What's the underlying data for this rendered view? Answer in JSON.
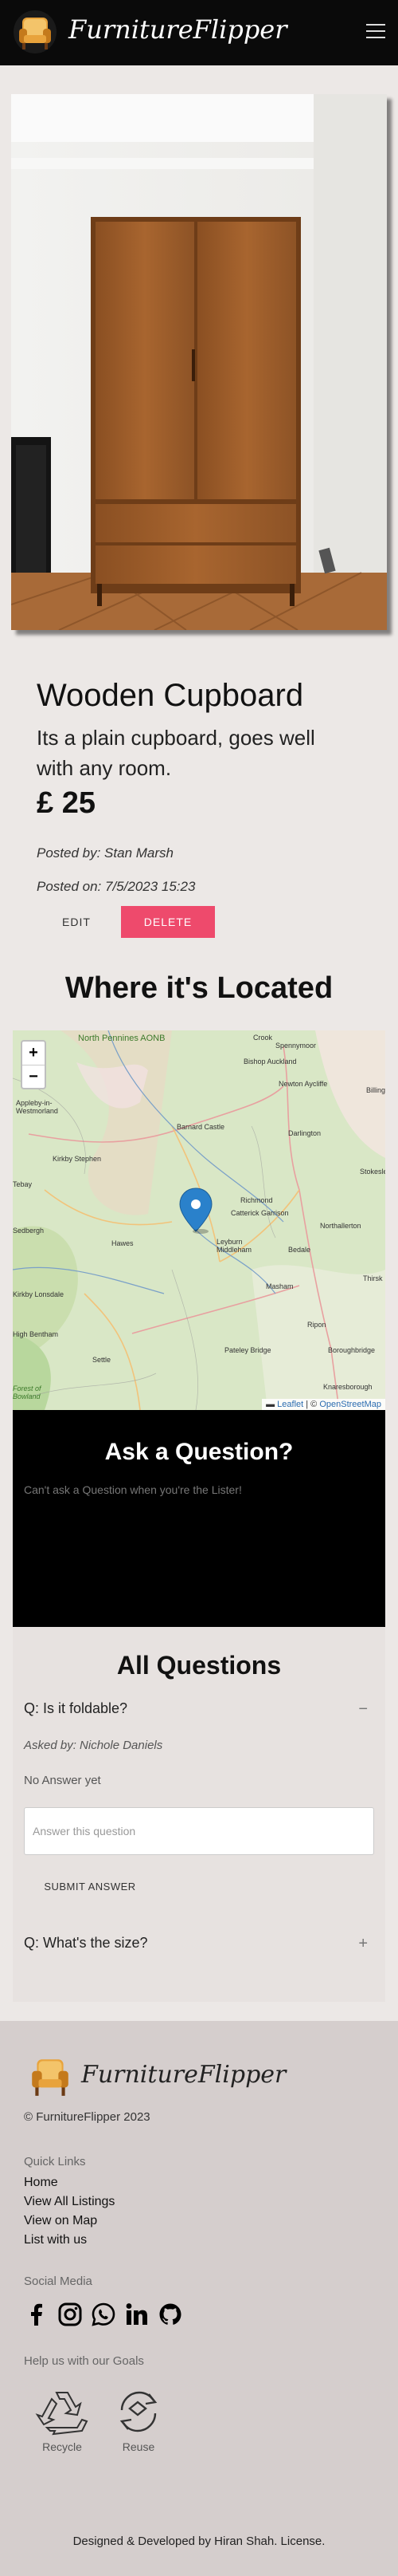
{
  "navbar": {
    "brand": "FurnitureFlipper"
  },
  "listing": {
    "title": "Wooden Cupboard",
    "description": "Its a plain cupboard, goes well with any room.",
    "price": "£ 25",
    "posted_by": "Posted by: Stan Marsh",
    "posted_on": "Posted on: 7/5/2023 15:23",
    "edit_label": "EDIT",
    "delete_label": "DELETE"
  },
  "map": {
    "heading": "Where it's Located",
    "zoom_in": "+",
    "zoom_out": "−",
    "attribution_leaflet": "Leaflet",
    "attribution_sep": " | © ",
    "attribution_osm": "OpenStreetMap",
    "labels": [
      "North Pennines AONB",
      "Crook",
      "Spennymoor",
      "Bishop Auckland",
      "Newton Aycliffe",
      "Darlington",
      "Appleby-in-Westmorland",
      "Barnard Castle",
      "Kirkby Stephen",
      "Richmond",
      "Catterick Garrison",
      "Northallerton",
      "Leyburn",
      "Middleham",
      "Bedale",
      "Hawes",
      "Masham",
      "Thirsk",
      "Sedbergh",
      "Ripon",
      "Pateley Bridge",
      "Boroughbridge",
      "High Bentham",
      "Settle",
      "Forest of Bowland",
      "Knaresborough",
      "Billingham",
      "Stokesley",
      "Kirkby Lonsdale",
      "Tebay"
    ]
  },
  "ask": {
    "title": "Ask a Question?",
    "note": "Can't ask a Question when you're the Lister!"
  },
  "questions": {
    "heading": "All Questions",
    "items": [
      {
        "question": "Q: Is it foldable?",
        "toggle": "−",
        "asked_by": "Asked by: Nichole Daniels",
        "answer_status": "No Answer yet",
        "answer_placeholder": "Answer this question",
        "submit_label": "SUBMIT ANSWER"
      },
      {
        "question": "Q: What's the size?",
        "toggle": "+"
      }
    ]
  },
  "footer": {
    "brand": "FurnitureFlipper",
    "copyright": "© FurnitureFlipper 2023",
    "quick_links_heading": "Quick Links",
    "links": [
      "Home",
      "View All Listings",
      "View on Map",
      "List with us"
    ],
    "social_heading": "Social Media",
    "social": [
      "facebook-icon",
      "instagram-icon",
      "whatsapp-icon",
      "linkedin-icon",
      "github-icon"
    ],
    "goals_heading": "Help us with our Goals",
    "goals": [
      "Recycle",
      "Reuse"
    ],
    "credit": "Designed & Developed by Hiran Shah. License."
  },
  "colors": {
    "navbar": "#0a0a0a",
    "delete": "#ee4a6c",
    "page_bg": "#ece8e6",
    "footer_bg": "#d5cecd",
    "map_marker": "#2a81cb"
  }
}
